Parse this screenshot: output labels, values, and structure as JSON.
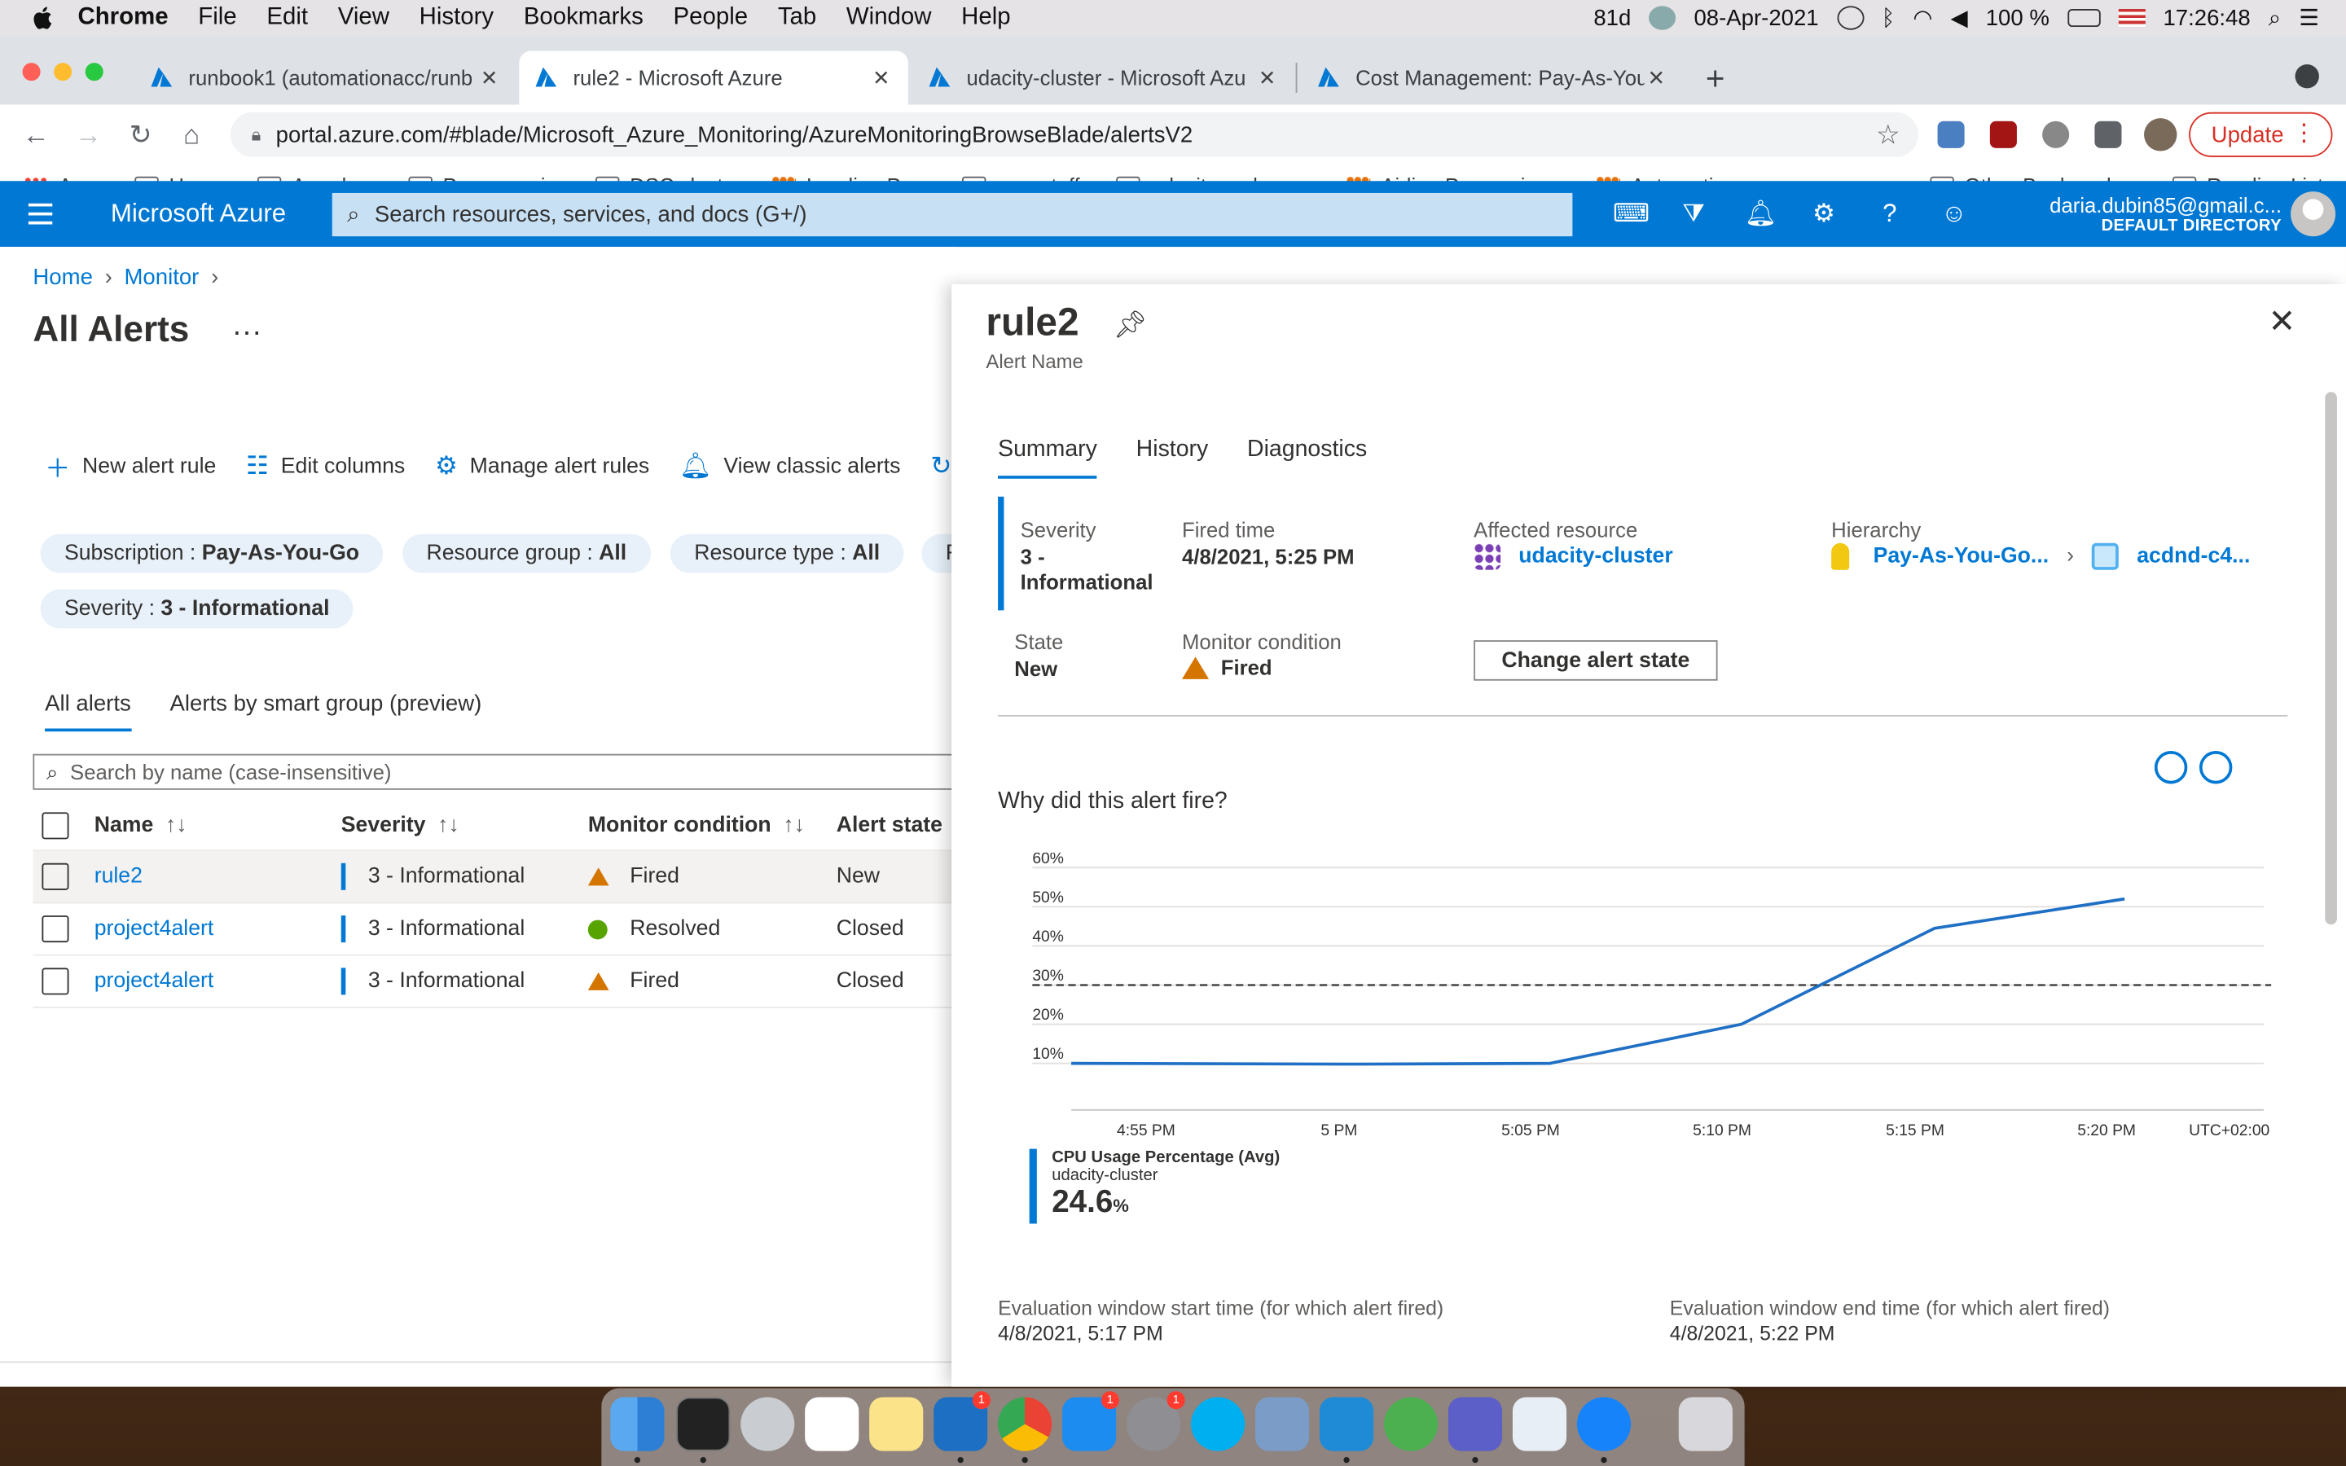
{
  "menubar": {
    "app_name": "Chrome",
    "items": [
      "File",
      "Edit",
      "View",
      "History",
      "Bookmarks",
      "People",
      "Tab",
      "Window",
      "Help"
    ],
    "status": {
      "temp": "81d",
      "date": "08-Apr-2021",
      "battery": "100 %",
      "time": "17:26:48"
    }
  },
  "browser": {
    "tabs": [
      {
        "title": "runbook1 (automationacc/runb",
        "active": false
      },
      {
        "title": "rule2 - Microsoft Azure",
        "active": true
      },
      {
        "title": "udacity-cluster - Microsoft Azu",
        "active": false
      },
      {
        "title": "Cost Management: Pay-As-You",
        "active": false
      }
    ],
    "url": "portal.azure.com/#blade/Microsoft_Azure_Monitoring/AzureMonitoringBrowseBlade/alertsV2",
    "update_label": "Update",
    "bookmarks": [
      "Apps",
      "Home",
      "Amadeus",
      "Programming",
      "DSC cluster",
      "Landing Page",
      "new stuff",
      "udacity and azure",
      "Airline Processing...",
      "Automatic proces...",
      "Other Bookmarks",
      "Reading List"
    ]
  },
  "azure": {
    "brand": "Microsoft Azure",
    "search_placeholder": "Search resources, services, and docs (G+/)",
    "account_email": "daria.dubin85@gmail.c...",
    "account_directory": "DEFAULT DIRECTORY"
  },
  "alerts": {
    "breadcrumb": [
      "Home",
      "Monitor"
    ],
    "title": "All Alerts",
    "commands": [
      "New alert rule",
      "Edit columns",
      "Manage alert rules",
      "View classic alerts",
      "Re"
    ],
    "filters": [
      {
        "label": "Subscription :",
        "value": "Pay-As-You-Go"
      },
      {
        "label": "Resource group :",
        "value": "All"
      },
      {
        "label": "Resource type :",
        "value": "All"
      },
      {
        "label": "F",
        "value": ""
      },
      {
        "label": "Severity :",
        "value": "3 - Informational"
      }
    ],
    "tabs": [
      "All alerts",
      "Alerts by smart group (preview)"
    ],
    "search_placeholder": "Search by name (case-insensitive)",
    "columns": [
      "Name",
      "Severity",
      "Monitor condition",
      "Alert state"
    ],
    "rows": [
      {
        "name": "rule2",
        "severity": "3 - Informational",
        "condition": "Fired",
        "state": "New"
      },
      {
        "name": "project4alert",
        "severity": "3 - Informational",
        "condition": "Resolved",
        "state": "Closed"
      },
      {
        "name": "project4alert",
        "severity": "3 - Informational",
        "condition": "Fired",
        "state": "Closed"
      }
    ]
  },
  "detail": {
    "title": "rule2",
    "subtitle": "Alert Name",
    "tabs": [
      "Summary",
      "History",
      "Diagnostics"
    ],
    "severity_label": "Severity",
    "severity_value_line1": "3 -",
    "severity_value_line2": "Informational",
    "fired_time_label": "Fired time",
    "fired_time_value": "4/8/2021, 5:25 PM",
    "affected_label": "Affected resource",
    "affected_value": "udacity-cluster",
    "hierarchy_label": "Hierarchy",
    "hierarchy_sub": "Pay-As-You-Go...",
    "hierarchy_rg": "acdnd-c4...",
    "state_label": "State",
    "state_value": "New",
    "monitor_label": "Monitor condition",
    "monitor_value": "Fired",
    "change_state_label": "Change alert state",
    "why_title": "Why did this alert fire?",
    "eval_start_label": "Evaluation window start time (for which alert fired)",
    "eval_start_value": "4/8/2021, 5:17 PM",
    "eval_end_label": "Evaluation window end time (for which alert fired)",
    "eval_end_value": "4/8/2021, 5:22 PM"
  },
  "chart_data": {
    "type": "line",
    "title": "",
    "x": [
      "4:52 PM",
      "5:00 PM",
      "5:05 PM",
      "5:10 PM",
      "5:15 PM",
      "5:20 PM"
    ],
    "x_ticks": [
      "4:55 PM",
      "5 PM",
      "5:05 PM",
      "5:10 PM",
      "5:15 PM",
      "5:20 PM",
      "UTC+02:00"
    ],
    "y_ticks": [
      "60%",
      "50%",
      "40%",
      "30%",
      "20%",
      "10%"
    ],
    "ylim": [
      0,
      60
    ],
    "threshold": 30,
    "series": [
      {
        "name": "CPU Usage Percentage (Avg)",
        "values": [
          10,
          9.8,
          10,
          20,
          44.5,
          52
        ]
      }
    ],
    "legend": {
      "name": "CPU Usage Percentage (Avg)",
      "resource": "udacity-cluster",
      "value": "24.6",
      "unit": "%"
    }
  },
  "colors": {
    "azure_blue": "#0078d4",
    "warning": "#d47500",
    "ok": "#57a300"
  }
}
